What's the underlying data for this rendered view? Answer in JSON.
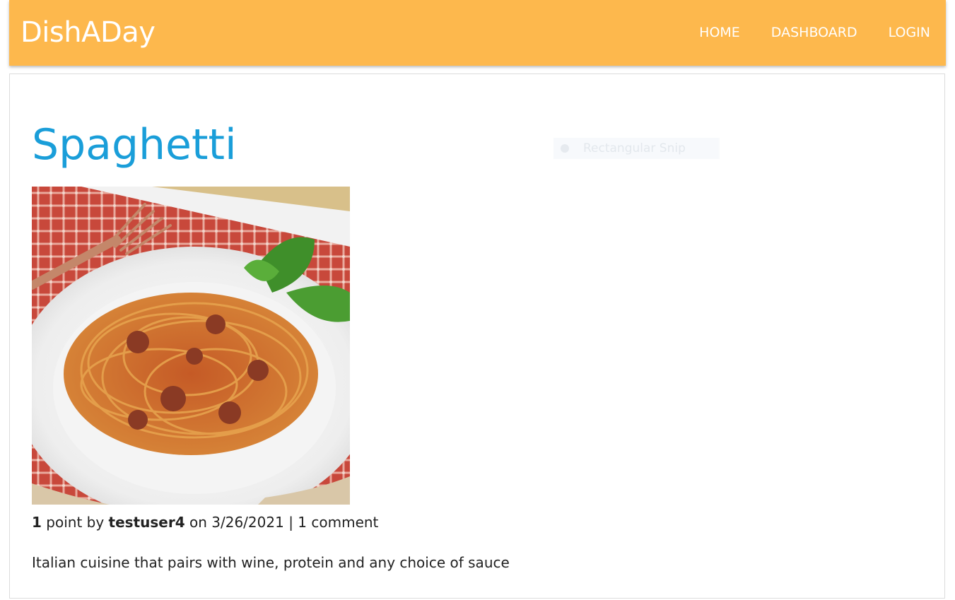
{
  "navbar": {
    "brand": "DishADay",
    "links": [
      {
        "label": "HOME"
      },
      {
        "label": "DASHBOARD"
      },
      {
        "label": "LOGIN"
      }
    ],
    "color": "#fdb84d"
  },
  "overlay": {
    "label": "Rectangular Snip"
  },
  "post": {
    "title": "Spaghetti",
    "title_color": "#1a9ed9",
    "image": {
      "subject": "plate of spaghetti with meat sauce and basil"
    },
    "points": "1",
    "points_label": "point by",
    "author": "testuser4",
    "on_label": "on",
    "date": "3/26/2021",
    "separator": "|",
    "comments": "1 comment",
    "description": "Italian cuisine that pairs with wine, protein and any choice of sauce"
  }
}
